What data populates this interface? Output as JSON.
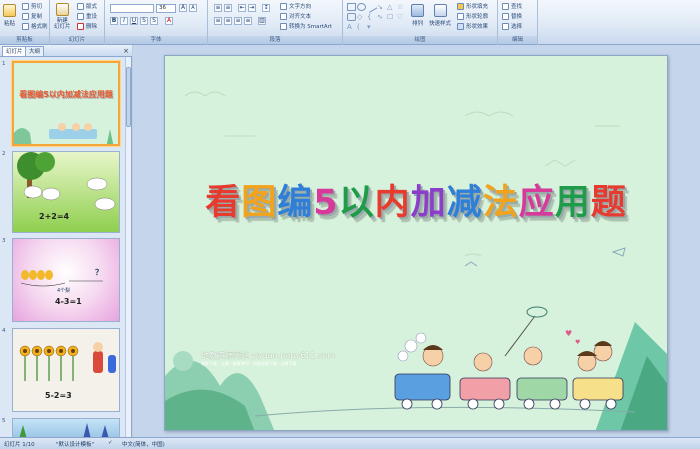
{
  "ribbon": {
    "clipboard": {
      "paste": "粘贴",
      "cut": "剪切",
      "copy": "复制",
      "format_painter": "格式刷",
      "label": "剪贴板"
    },
    "slides": {
      "new_slide": "新建\n幻灯片",
      "layout": "版式",
      "reset": "重设",
      "delete": "删除",
      "label": "幻灯片"
    },
    "font": {
      "font_name": "",
      "font_size": "36",
      "grow": "A",
      "shrink": "A",
      "label": "字体"
    },
    "paragraph": {
      "text_direction": "文字方向",
      "align_text": "对齐文本",
      "convert_smartart": "转换为 SmartArt",
      "label": "段落"
    },
    "drawing": {
      "arrange": "排列",
      "quick_styles": "快速样式",
      "shape_fill": "形状填充",
      "shape_outline": "形状轮廓",
      "shape_effects": "形状效果",
      "label": "绘图"
    },
    "editing": {
      "find": "查找",
      "replace": "替换",
      "select": "选择",
      "label": "编辑"
    }
  },
  "panel": {
    "tab_slides": "幻灯片",
    "tab_outline": "大纲",
    "close": "×",
    "slides": [
      {
        "num": "1",
        "title": "看图编5以内加减法应用题"
      },
      {
        "num": "2",
        "caption": "2+2=4"
      },
      {
        "num": "3",
        "label": "4个梨",
        "question": "？",
        "caption": "4-3=1"
      },
      {
        "num": "4",
        "caption": "5-2=3"
      },
      {
        "num": "5"
      }
    ]
  },
  "slide": {
    "title_chars": [
      "看",
      "图",
      "编",
      "5",
      "以",
      "内",
      "加",
      "减",
      "法",
      "应",
      "用",
      "题"
    ],
    "title_colors": [
      "#e63b2e",
      "#f2a31c",
      "#2f7fd8",
      "#d63a9a",
      "#1e9c4a",
      "#e63b2e",
      "#8b3fc9",
      "#2f7fd8",
      "#f2a31c",
      "#d63a9a",
      "#1e9c4a",
      "#e63b2e"
    ],
    "site": "幼教资源网站  ziyuan.baby611.com",
    "site_sub": "课件下载 · 儿歌 · 故事MP3 · 动画视频下载 · 试卷下载"
  },
  "status": {
    "slide_count": "幻灯片 1/10",
    "theme": "\"默认设计模板\"",
    "language": "中文(简体，中国)"
  }
}
